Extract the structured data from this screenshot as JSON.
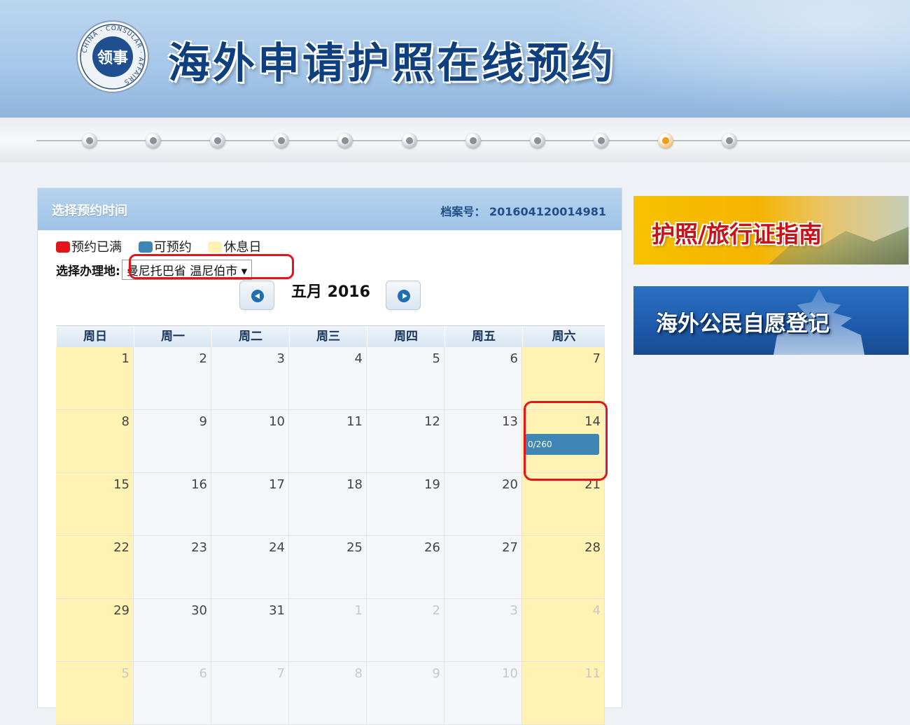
{
  "header": {
    "site_title": "海外申请护照在线预约",
    "logo_center": "领事",
    "logo_ring": "CHINA · CONSULAR · AFFAIRS"
  },
  "steps": {
    "count": 11,
    "active_step": 10
  },
  "panel": {
    "title": "选择预约时间",
    "file_number_label": "档案号：",
    "file_number": "201604120014981"
  },
  "legend": {
    "full": {
      "label": "预约已满",
      "color": "#e3141c"
    },
    "available": {
      "label": "可预约",
      "color": "#3f86b4"
    },
    "rest": {
      "label": "休息日",
      "color": "#fff2b3"
    }
  },
  "location": {
    "label": "选择办理地:",
    "selected": "曼尼托巴省 温尼伯市 ▾"
  },
  "calendar": {
    "month_title": "五月 2016",
    "weekdays": [
      "周日",
      "周一",
      "周二",
      "周三",
      "周四",
      "周五",
      "周六"
    ],
    "weeks": [
      [
        {
          "d": "1"
        },
        {
          "d": "2"
        },
        {
          "d": "3"
        },
        {
          "d": "4"
        },
        {
          "d": "5"
        },
        {
          "d": "6"
        },
        {
          "d": "7"
        }
      ],
      [
        {
          "d": "8"
        },
        {
          "d": "9"
        },
        {
          "d": "10"
        },
        {
          "d": "11"
        },
        {
          "d": "12"
        },
        {
          "d": "13"
        },
        {
          "d": "14",
          "slot": "0/260"
        }
      ],
      [
        {
          "d": "15"
        },
        {
          "d": "16"
        },
        {
          "d": "17"
        },
        {
          "d": "18"
        },
        {
          "d": "19"
        },
        {
          "d": "20"
        },
        {
          "d": "21"
        }
      ],
      [
        {
          "d": "22"
        },
        {
          "d": "23"
        },
        {
          "d": "24"
        },
        {
          "d": "25"
        },
        {
          "d": "26"
        },
        {
          "d": "27"
        },
        {
          "d": "28"
        }
      ],
      [
        {
          "d": "29"
        },
        {
          "d": "30"
        },
        {
          "d": "31"
        },
        {
          "d": "1",
          "other": true
        },
        {
          "d": "2",
          "other": true
        },
        {
          "d": "3",
          "other": true
        },
        {
          "d": "4",
          "other": true
        }
      ],
      [
        {
          "d": "5",
          "other": true
        },
        {
          "d": "6",
          "other": true
        },
        {
          "d": "7",
          "other": true
        },
        {
          "d": "8",
          "other": true
        },
        {
          "d": "9",
          "other": true
        },
        {
          "d": "10",
          "other": true
        },
        {
          "d": "11",
          "other": true
        }
      ]
    ]
  },
  "banners": {
    "guide": "护照/旅行证指南",
    "registration": "海外公民自愿登记"
  }
}
